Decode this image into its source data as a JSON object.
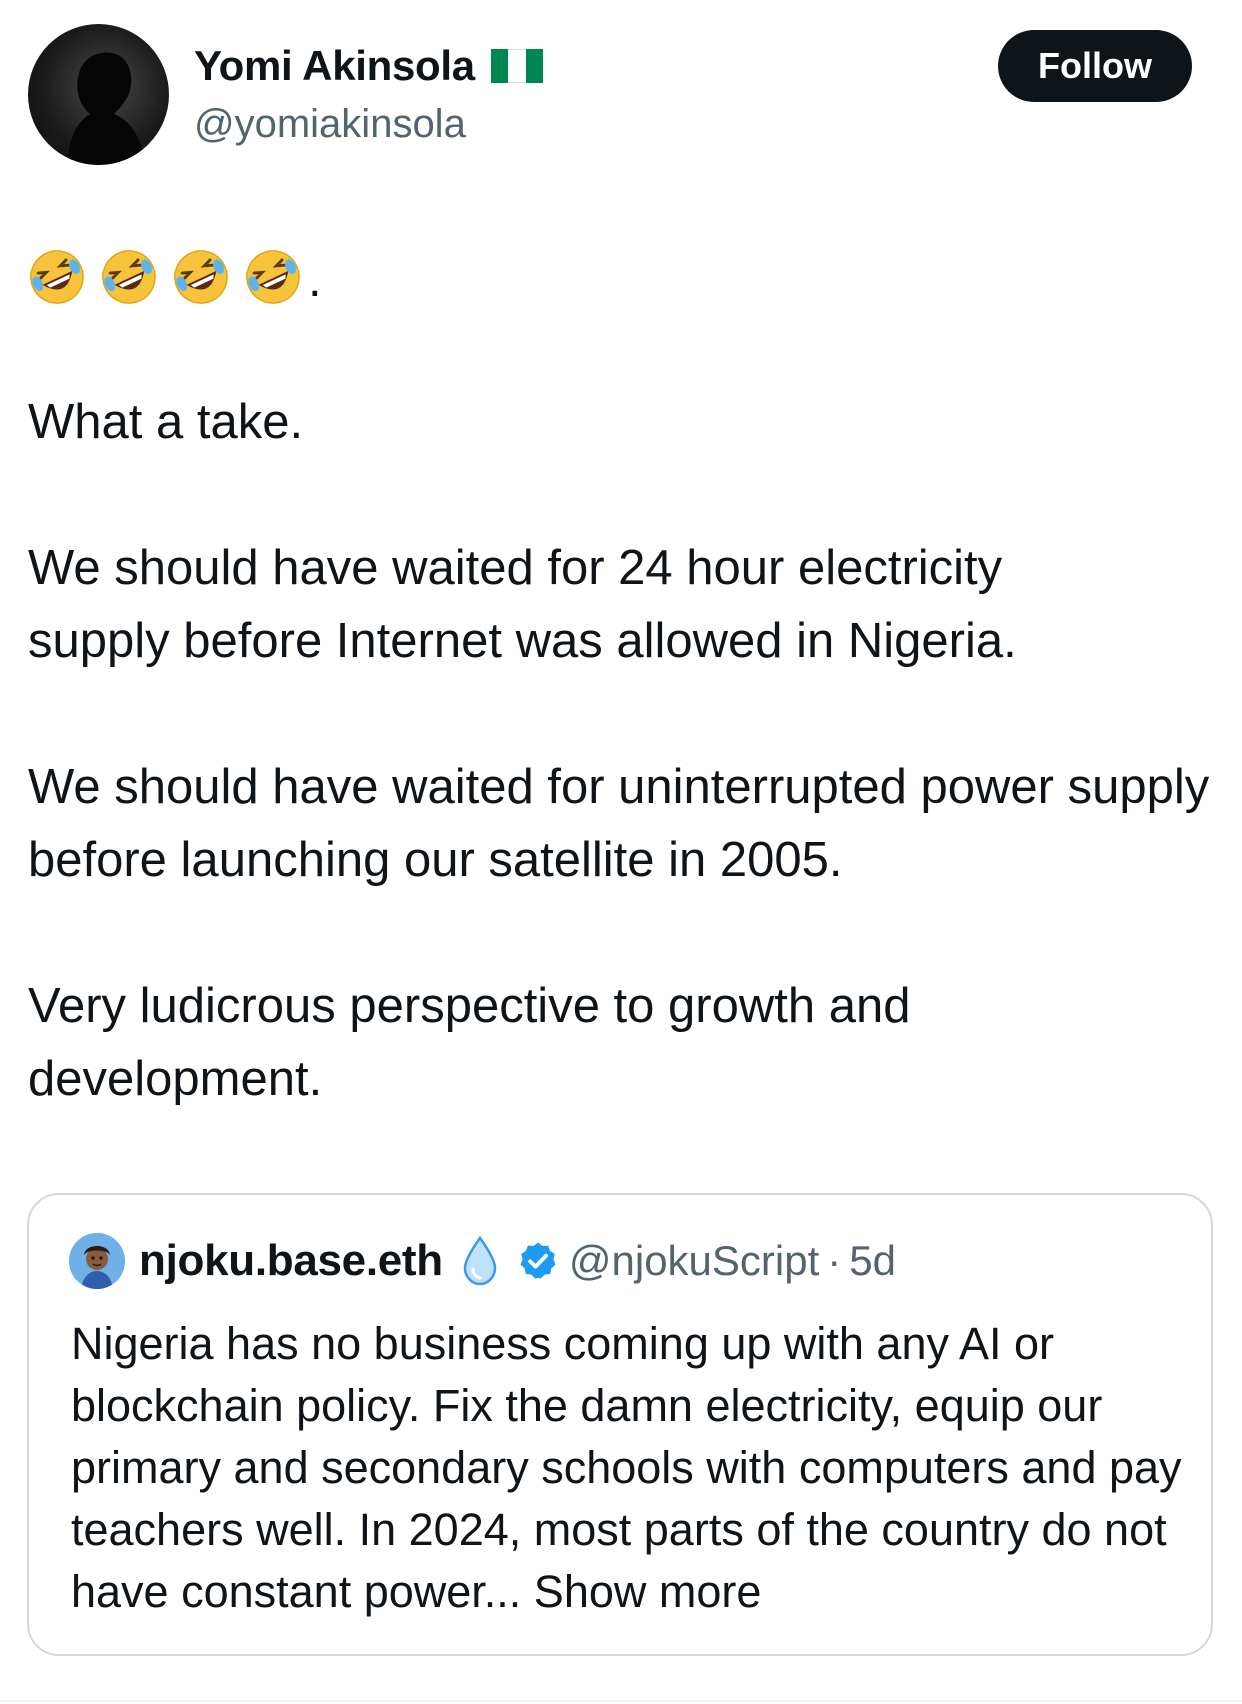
{
  "author": {
    "display_name": "Yomi Akinsola",
    "handle": "@yomiakinsola",
    "flag": "nigeria-flag-icon",
    "flag_colors": [
      "#008751",
      "#ffffff",
      "#008751"
    ]
  },
  "actions": {
    "follow_label": "Follow"
  },
  "tweet": {
    "emoji": [
      "rolling-on-floor-laughing-icon",
      "rolling-on-floor-laughing-icon",
      "rolling-on-floor-laughing-icon",
      "rolling-on-floor-laughing-icon"
    ],
    "emoji_trailing": ".",
    "paragraphs": [
      "What a take.",
      "We should have waited for 24 hour electricity supply before Internet was allowed in Nigeria.",
      "We should have waited for uninterrupted power supply before launching our satellite in 2005.",
      "Very ludicrous perspective to growth and development."
    ]
  },
  "quoted_tweet": {
    "display_name": "njoku.base.eth",
    "name_emoji": "droplet-icon",
    "verified": true,
    "handle": "@njokuScript",
    "separator": "·",
    "time": "5d",
    "text": "Nigeria has no business coming up with any AI or blockchain policy. Fix the damn electricity, equip our primary and secondary schools with computers and pay teachers well. In 2024, most parts of the country do not have constant power...",
    "show_more_label": " Show more"
  },
  "colors": {
    "text_primary": "#0f1419",
    "text_secondary": "#536471",
    "border": "#cfd9de",
    "verified_blue": "#1d9bf0",
    "follow_bg": "#0f1419"
  }
}
